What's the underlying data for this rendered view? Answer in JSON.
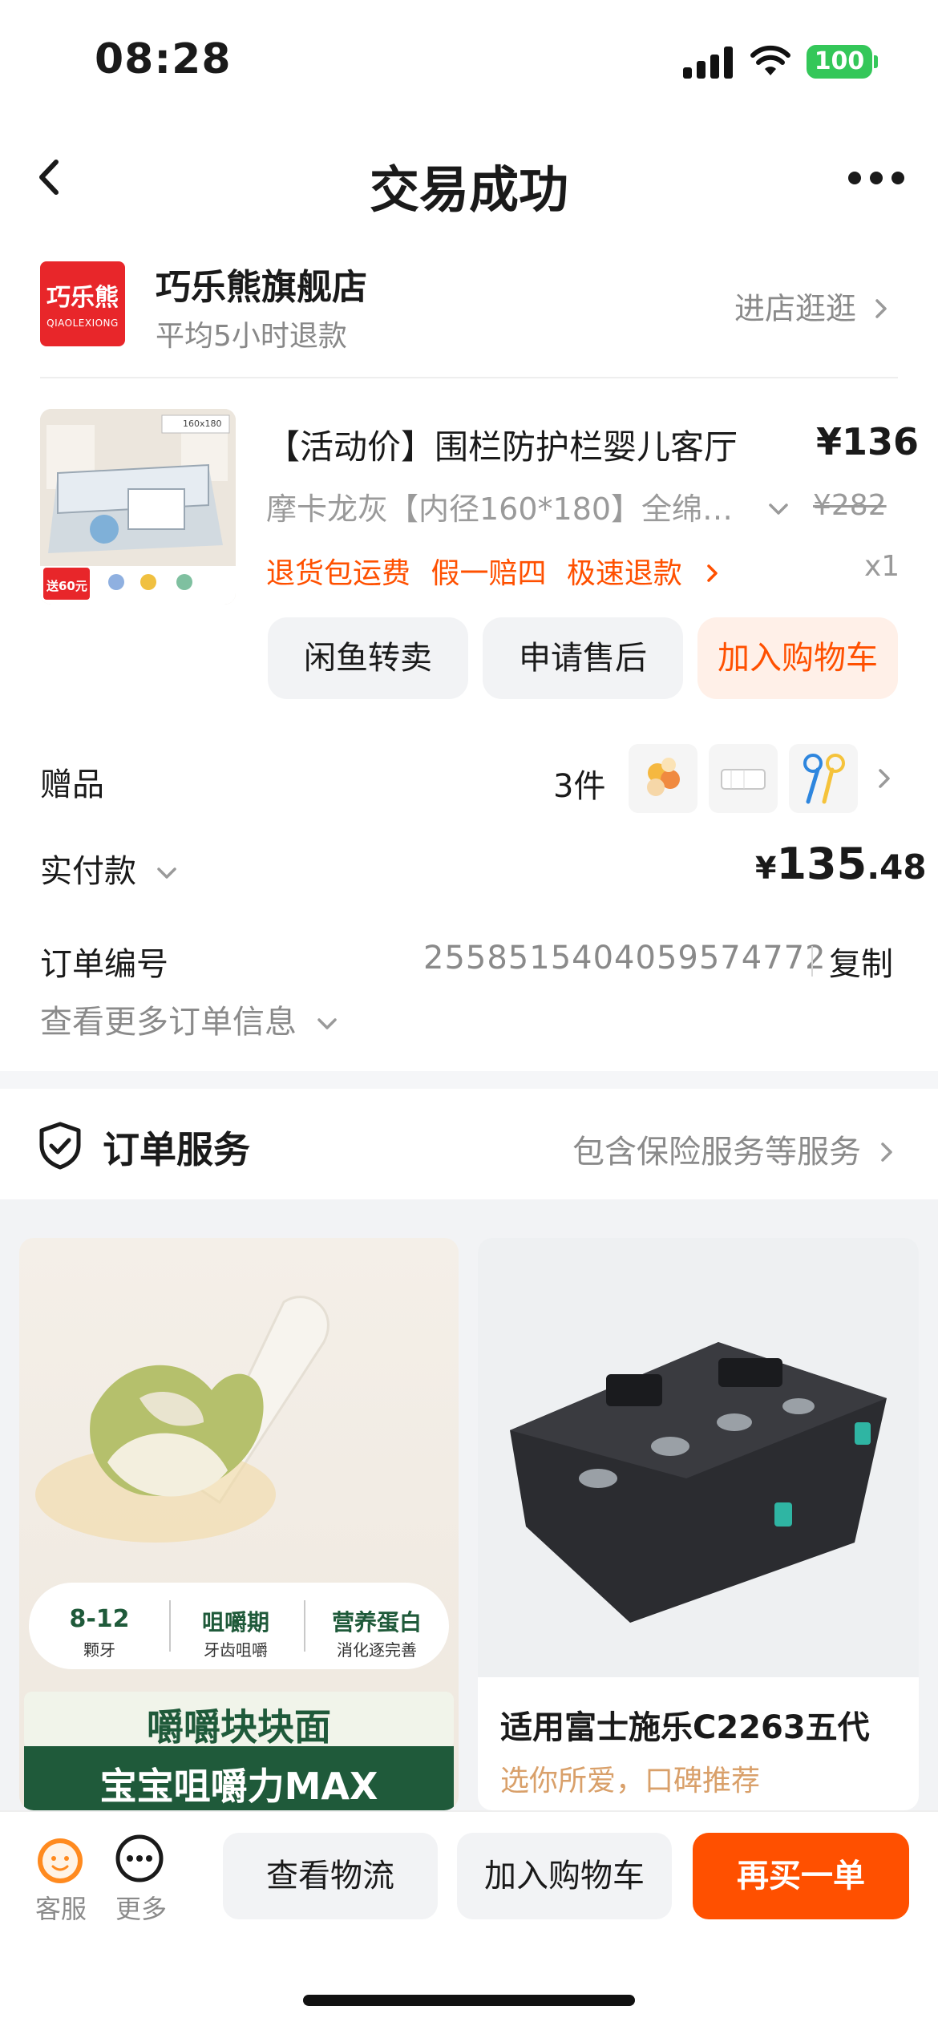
{
  "status_bar": {
    "time": "08:28",
    "battery": "100"
  },
  "nav": {
    "title": "交易成功"
  },
  "shop": {
    "logo_text": "巧乐熊",
    "logo_sub": "QIAOLEXIONG",
    "name": "巧乐熊旗舰店",
    "subtitle": "平均5小时退款",
    "link": "进店逛逛"
  },
  "product": {
    "title": "【活动价】围栏防护栏婴儿客厅",
    "price": "¥136",
    "sku": "摩卡龙灰【内径160*180】全绵…",
    "original_price": "¥282",
    "tags": "退货包运费 假一赔四 极速退款",
    "quantity": "x1",
    "thumb_badge": "送60元",
    "thumb_size": "160x180"
  },
  "actions": {
    "resell": "闲鱼转卖",
    "after_sale": "申请售后",
    "add_cart": "加入购物车"
  },
  "gifts": {
    "label": "赠品",
    "count": "3件"
  },
  "payment": {
    "label": "实付款",
    "symbol": "¥",
    "integer": "135",
    "decimal": ".48"
  },
  "order": {
    "label": "订单编号",
    "number": "2558515404059574772",
    "copy": "复制",
    "more": "查看更多订单信息"
  },
  "service": {
    "title": "订单服务",
    "link": "包含保险服务等服务"
  },
  "feed": {
    "left": {
      "stat1_big": "8-12",
      "stat1_small": "颗牙",
      "stat2_big": "咀嚼期",
      "stat2_small": "牙齿咀嚼",
      "stat3_big": "营养蛋白",
      "stat3_small": "消化逐完善",
      "banner1": "嚼嚼块块面",
      "banner2": "宝宝咀嚼力MAX"
    },
    "right": {
      "title": "适用富士施乐C2263五代",
      "subtitle": "选你所爱，口碑推荐"
    }
  },
  "bottom": {
    "customer_service": "客服",
    "more": "更多",
    "logistics": "查看物流",
    "add_cart": "加入购物车",
    "rebuy": "再买一单"
  },
  "colors": {
    "accent": "#ff5000",
    "accent_soft": "#fff0e8",
    "muted": "#8a8a8a",
    "brand_red": "#e8262a"
  }
}
